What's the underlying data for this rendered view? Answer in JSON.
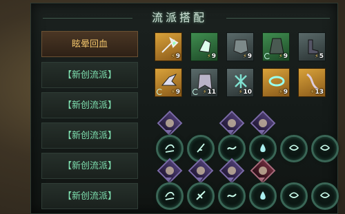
{
  "title": "流派搭配",
  "slots": [
    {
      "label": "眩晕回血",
      "active": true
    },
    {
      "label": "【新创流派】",
      "active": false
    },
    {
      "label": "【新创流派】",
      "active": false
    },
    {
      "label": "【新创流派】",
      "active": false
    },
    {
      "label": "【新创流派】",
      "active": false
    },
    {
      "label": "【新创流派】",
      "active": false
    }
  ],
  "equipment_row1": [
    {
      "name": "axe-icon",
      "rarity": "gold",
      "level": "9",
      "cycle": false
    },
    {
      "name": "gauntlet-icon",
      "rarity": "green",
      "level": "9",
      "cycle": false
    },
    {
      "name": "armor-icon",
      "rarity": "grey",
      "level": "9",
      "cycle": false
    },
    {
      "name": "robe-icon",
      "rarity": "green",
      "level": "9",
      "cycle": true
    },
    {
      "name": "boots-icon",
      "rarity": "grey",
      "level": "5",
      "cycle": false
    }
  ],
  "equipment_row2": [
    {
      "name": "claw-icon",
      "rarity": "gold",
      "level": "9",
      "cycle": true
    },
    {
      "name": "cloak-icon",
      "rarity": "grey",
      "level": "11",
      "cycle": true
    },
    {
      "name": "rune-icon",
      "rarity": "grey",
      "level": "10",
      "cycle": false
    },
    {
      "name": "ring-icon",
      "rarity": "gold",
      "level": "9",
      "cycle": false
    },
    {
      "name": "chain-icon",
      "rarity": "gold",
      "level": "13",
      "cycle": false
    }
  ],
  "skills_row1": [
    {
      "name": "skill-wind-icon",
      "avatar": true,
      "avatar_color": "purple"
    },
    {
      "name": "skill-feather-icon",
      "avatar": false
    },
    {
      "name": "skill-wave-icon",
      "avatar": true,
      "avatar_color": "purple"
    },
    {
      "name": "skill-drop-icon",
      "avatar": true,
      "avatar_color": "purple"
    },
    {
      "name": "skill-eye-icon",
      "avatar": false
    },
    {
      "name": "skill-eye-icon",
      "avatar": false
    }
  ],
  "skills_row2": [
    {
      "name": "skill-wind-icon",
      "avatar": true,
      "avatar_color": "purple"
    },
    {
      "name": "skill-slash-icon",
      "avatar": true,
      "avatar_color": "purple"
    },
    {
      "name": "skill-wave-icon",
      "avatar": true,
      "avatar_color": "purple"
    },
    {
      "name": "skill-drop-icon",
      "avatar": true,
      "avatar_color": "red"
    },
    {
      "name": "skill-eye-icon",
      "avatar": false
    },
    {
      "name": "skill-eye-icon",
      "avatar": false
    }
  ]
}
